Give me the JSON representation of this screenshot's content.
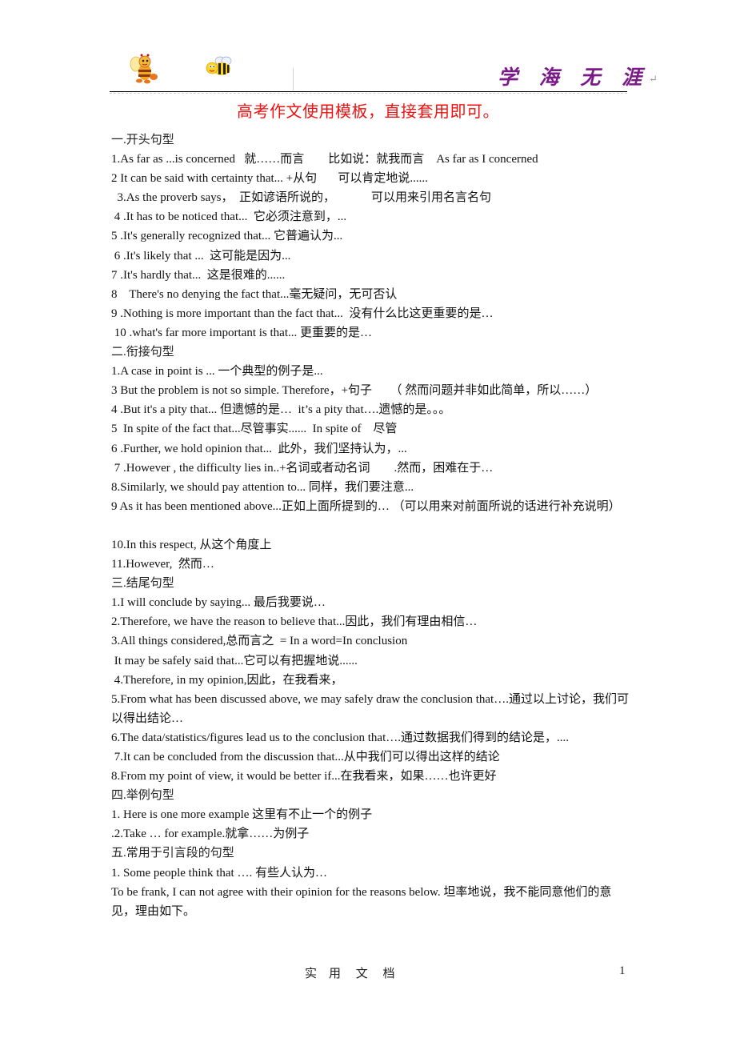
{
  "header": {
    "brand_text": "学 海 无 涯",
    "para_mark": "↵",
    "brand_color": "#7a1a88",
    "left_icons": [
      "bee-mascot-icon",
      "bee-icon"
    ]
  },
  "title": "高考作文使用模板，直接套用即可。",
  "title_color": "#ee1111",
  "lines": [
    {
      "type": "section",
      "text": "一.开头句型"
    },
    {
      "type": "item",
      "text": "1.As far as ...is concerned   就……而言        比如说：就我而言    As far as I concerned"
    },
    {
      "type": "item",
      "text": "2 It can be said with certainty that... +从句       可以肯定地说......"
    },
    {
      "type": "item",
      "text": "  3.As the proverb says，  正如谚语所说的，            可以用来引用名言名句"
    },
    {
      "type": "item",
      "text": " 4 .It has to be noticed that...  它必须注意到，..."
    },
    {
      "type": "item",
      "text": "5 .It's generally recognized that... 它普遍认为..."
    },
    {
      "type": "item",
      "text": " 6 .It's likely that ...  这可能是因为..."
    },
    {
      "type": "item",
      "text": "7 .It's hardly that...  这是很难的......"
    },
    {
      "type": "item",
      "text": "8    There's no denying the fact that...毫无疑问，无可否认"
    },
    {
      "type": "item",
      "text": "9 .Nothing is more important than the fact that...  没有什么比这更重要的是…"
    },
    {
      "type": "item",
      "text": " 10 .what's far more important is that... 更重要的是…"
    },
    {
      "type": "section",
      "text": "二.衔接句型"
    },
    {
      "type": "item",
      "text": "1.A case in point is ... 一个典型的例子是..."
    },
    {
      "type": "item",
      "text": "3 But the problem is not so simple. Therefore，+句子      （ 然而问题并非如此简单，所以……）"
    },
    {
      "type": "item",
      "text": "4 .But it's a pity that... 但遗憾的是…  it’s a pity that….遗憾的是。。。"
    },
    {
      "type": "item",
      "text": "5  In spite of the fact that...尽管事实......  In spite of    尽管"
    },
    {
      "type": "item",
      "text": "6 .Further, we hold opinion that...  此外，我们坚持认为，..."
    },
    {
      "type": "item",
      "text": " 7 .However , the difficulty lies in..+名词或者动名词        .然而，困难在于…"
    },
    {
      "type": "item",
      "text": "8.Similarly, we should pay attention to... 同样，我们要注意..."
    },
    {
      "type": "wrap",
      "text": "9 As it has been mentioned above...正如上面所提到的… （可以用来对前面所说的话进行补充说明）"
    },
    {
      "type": "blank",
      "text": ""
    },
    {
      "type": "item",
      "text": "10.In this respect, 从这个角度上"
    },
    {
      "type": "item",
      "text": "11.However,  然而…"
    },
    {
      "type": "section",
      "text": "三.结尾句型"
    },
    {
      "type": "item",
      "text": "1.I will conclude by saying... 最后我要说…"
    },
    {
      "type": "item",
      "text": "2.Therefore, we have the reason to believe that...因此，我们有理由相信…"
    },
    {
      "type": "item",
      "text": "3.All things considered,总而言之  = In a word=In conclusion"
    },
    {
      "type": "item",
      "text": " It may be safely said that...它可以有把握地说......"
    },
    {
      "type": "item",
      "text": " 4.Therefore, in my opinion,因此，在我看来，"
    },
    {
      "type": "wrap",
      "text": "5.From what has been discussed above, we may safely draw the conclusion that….通过以上讨论，我们可以得出结论…"
    },
    {
      "type": "item",
      "text": "6.The data/statistics/figures lead us to the conclusion that….通过数据我们得到的结论是，...."
    },
    {
      "type": "item",
      "text": " 7.It can be concluded from the discussion that...从中我们可以得出这样的结论"
    },
    {
      "type": "item",
      "text": "8.From my point of view, it would be better if...在我看来，如果……也许更好"
    },
    {
      "type": "section",
      "text": "四.举例句型"
    },
    {
      "type": "item",
      "text": "1. Here is one more example 这里有不止一个的例子"
    },
    {
      "type": "item",
      "text": ".2.Take … for example.就拿……为例子"
    },
    {
      "type": "section",
      "text": "五.常用于引言段的句型"
    },
    {
      "type": "item",
      "text": "1. Some people think that …. 有些人认为…"
    },
    {
      "type": "wrap",
      "text": "To be frank, I can not agree with their opinion for the reasons below. 坦率地说，我不能同意他们的意见，理由如下。"
    }
  ],
  "footer": {
    "text": "实    用     文     档",
    "page_number": "1"
  }
}
